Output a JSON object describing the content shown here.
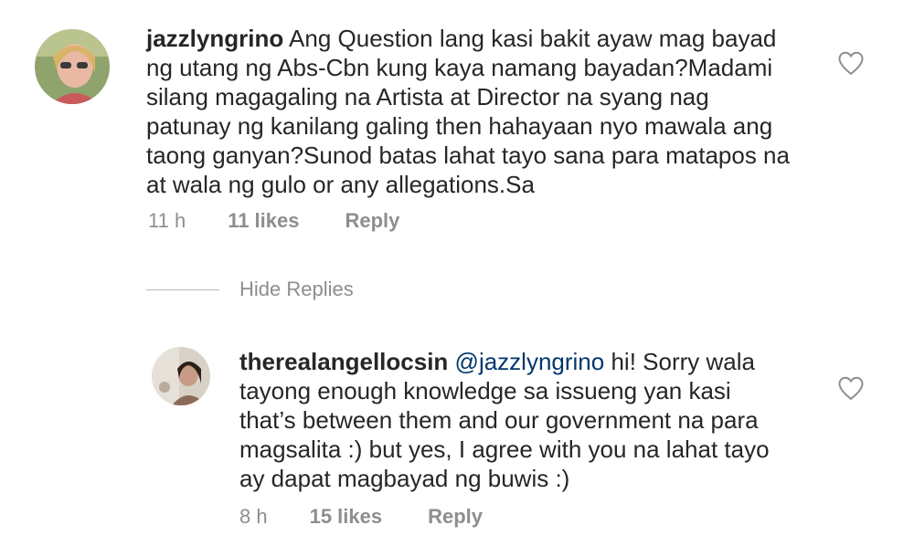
{
  "comments": [
    {
      "username": "jazzlyngrino",
      "text": "Ang Question lang kasi bakit ayaw mag bayad\nng utang ng Abs-Cbn kung kaya namang bayadan?Madami\nsilang magagaling na Artista at Director na syang nag\npatunay ng kanilang galing then  hahayaan nyo mawala ang\ntaong ganyan?Sunod batas lahat tayo sana para matapos na\nat wala ng gulo or any allegations.Sa",
      "time": "11 h",
      "likes": "11 likes",
      "reply_label": "Reply",
      "like_icon": "heart-outline-icon"
    }
  ],
  "replies_toggle": {
    "label": "Hide Replies"
  },
  "replies": [
    {
      "username": "therealangellocsin",
      "mention": "@jazzlyngrino",
      "text_first": " hi! Sorry wala",
      "text_rest": "tayong enough knowledge sa issueng yan kasi\nthat’s between them and our government na para\nmagsalita :) but yes, I agree with you na lahat tayo\nay dapat magbayad ng buwis :)",
      "time": "8 h",
      "likes": "15 likes",
      "reply_label": "Reply",
      "like_icon": "heart-outline-icon"
    }
  ],
  "colors": {
    "text": "#262626",
    "secondary": "#8e8e8e",
    "mention": "#00376b"
  }
}
